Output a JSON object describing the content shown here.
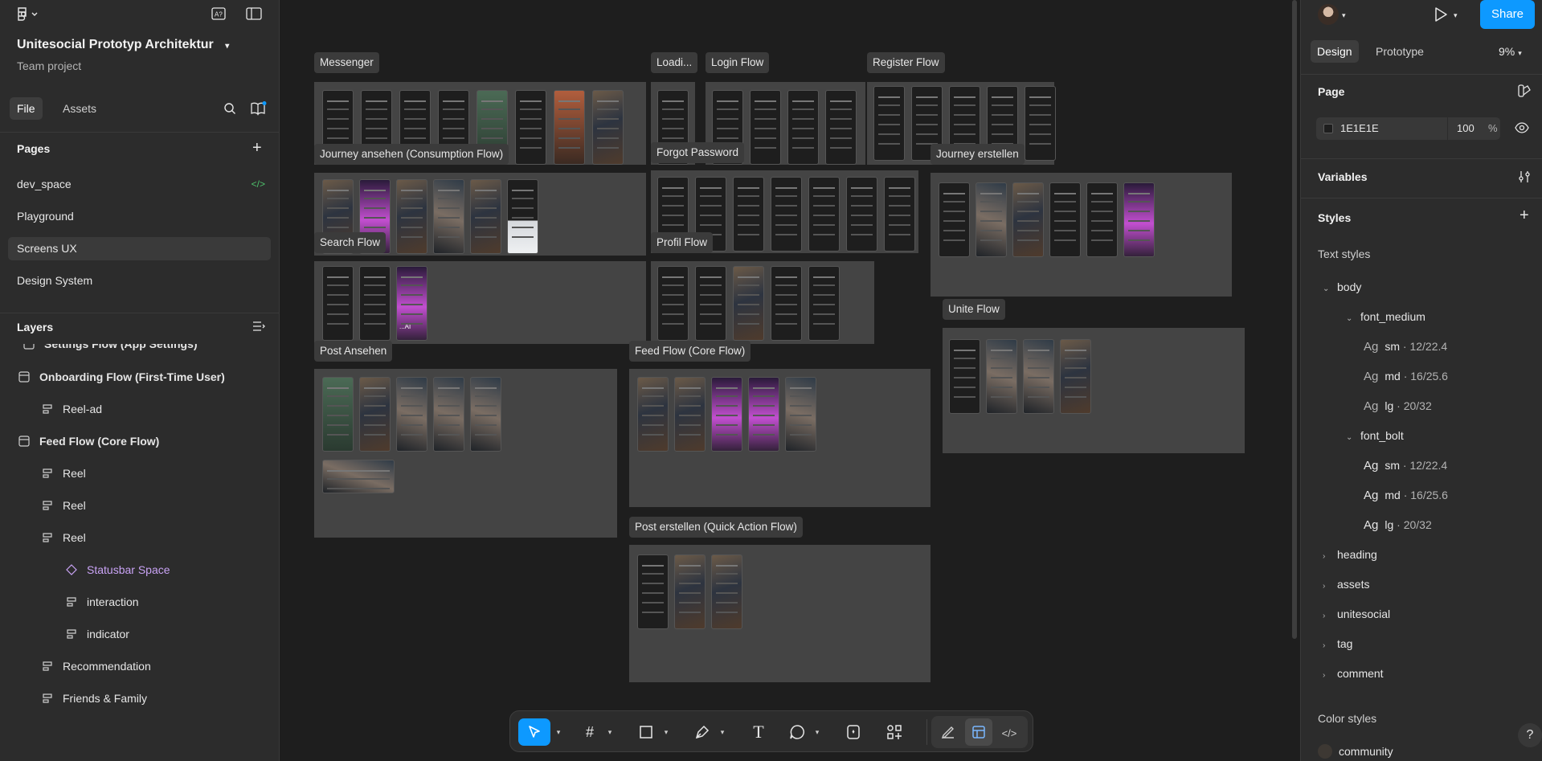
{
  "file": {
    "title": "Unitesocial Prototyp Architektur",
    "subtitle": "Team project"
  },
  "left_tabs": {
    "file": "File",
    "assets": "Assets"
  },
  "pages": {
    "heading": "Pages",
    "items": [
      "dev_space",
      "Playground",
      "Screens UX",
      "Design System"
    ]
  },
  "layers": {
    "heading": "Layers",
    "items": [
      "Settings Flow (App Settings)",
      "Onboarding Flow (First-Time User)",
      "Reel-ad",
      "Feed Flow (Core Flow)",
      "Reel",
      "Reel",
      "Reel",
      "Statusbar Space",
      "interaction",
      "indicator",
      "Recommendation",
      "Friends & Family"
    ]
  },
  "canvas": {
    "frames": [
      "Messenger",
      "Loadi...",
      "Login Flow",
      "Register Flow",
      "Journey ansehen (Consumption Flow)",
      "Forgot Password",
      "Journey erstellen",
      "Search Flow",
      "Profil Flow",
      "Unite Flow",
      "Post Ansehen",
      "Feed Flow (Core Flow)",
      "Post erstellen (Quick Action Flow)"
    ],
    "screen_caption": "...AI"
  },
  "right": {
    "share": "Share",
    "tabs": {
      "design": "Design",
      "prototype": "Prototype"
    },
    "zoom": "9%",
    "page": {
      "heading": "Page",
      "color": "1E1E1E",
      "opacity": "100",
      "percent": "%"
    },
    "variables": "Variables",
    "styles": "Styles",
    "text_styles": "Text styles",
    "body": "body",
    "font_medium": "font_medium",
    "font_bolt": "font_bolt",
    "ag": "Ag",
    "sizes": [
      {
        "name": "sm",
        "value": "· 12/22.4"
      },
      {
        "name": "md",
        "value": "· 16/25.6"
      },
      {
        "name": "lg",
        "value": "· 20/32"
      }
    ],
    "groups": [
      "heading",
      "assets",
      "unitesocial",
      "tag",
      "comment"
    ],
    "color_styles": "Color styles",
    "color_items": [
      "community"
    ],
    "help": "?"
  }
}
